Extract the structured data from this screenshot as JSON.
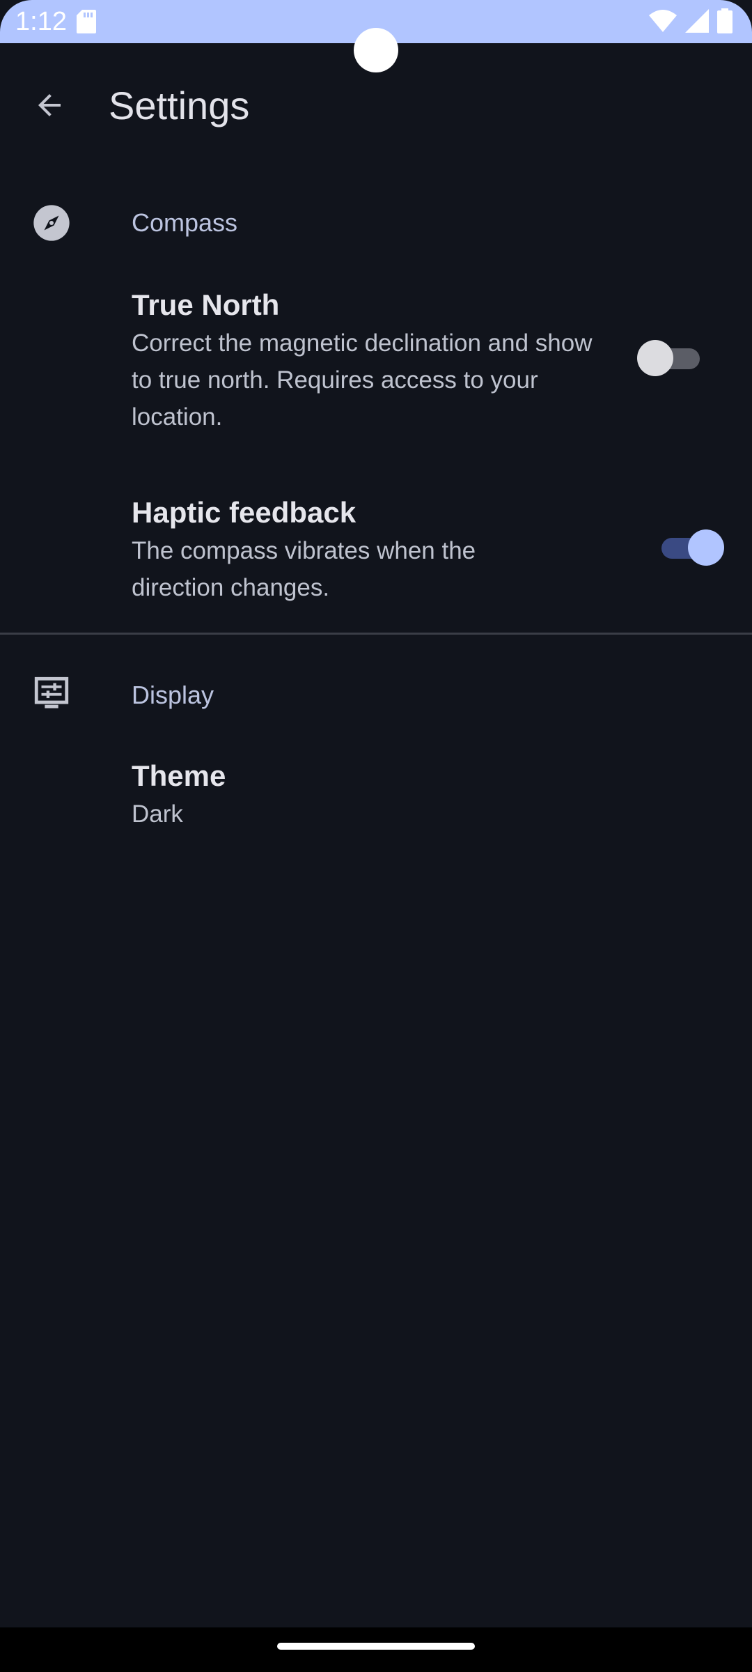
{
  "status_bar": {
    "time": "1:12",
    "background_color": "#b1c5ff",
    "icons": [
      "sd-card-icon",
      "wifi-icon",
      "cellular-signal-icon",
      "battery-icon"
    ]
  },
  "app_bar": {
    "title": "Settings",
    "back_icon": "arrow-back-icon"
  },
  "sections": {
    "compass": {
      "title": "Compass",
      "icon": "compass-icon",
      "prefs": {
        "true_north": {
          "title": "True North",
          "summary": "Correct the magnetic declination and show to true north. Requires access to your location.",
          "enabled": false
        },
        "haptic": {
          "title": "Haptic feedback",
          "summary": "The compass vibrates when the direction changes.",
          "enabled": true
        }
      }
    },
    "display": {
      "title": "Display",
      "icon": "display-settings-icon",
      "prefs": {
        "theme": {
          "title": "Theme",
          "summary": "Dark"
        }
      }
    }
  },
  "colors": {
    "background": "#11141c",
    "accent": "#b1c5ff",
    "switch_track_on": "#3a4a83"
  }
}
